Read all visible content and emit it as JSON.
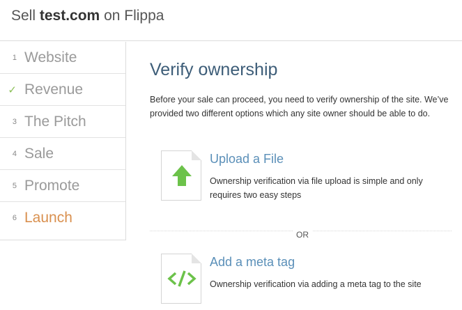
{
  "header": {
    "prefix": "Sell",
    "domain": "test.com",
    "suffix": "on Flippa"
  },
  "sidebar": {
    "steps": [
      {
        "marker": "1",
        "label": "Website",
        "status": "pending"
      },
      {
        "marker": "✓",
        "label": "Revenue",
        "status": "complete"
      },
      {
        "marker": "3",
        "label": "The Pitch",
        "status": "pending"
      },
      {
        "marker": "4",
        "label": "Sale",
        "status": "pending"
      },
      {
        "marker": "5",
        "label": "Promote",
        "status": "pending"
      },
      {
        "marker": "6",
        "label": "Launch",
        "status": "active"
      }
    ]
  },
  "main": {
    "title": "Verify ownership",
    "intro": "Before your sale can proceed, you need to verify ownership of the site. We’ve provided two different options which any site owner should be able to do.",
    "separator": "OR",
    "options": [
      {
        "title": "Upload a File",
        "description": "Ownership verification via file upload is simple and only requires two easy steps",
        "icon": "upload-arrow-icon"
      },
      {
        "title": "Add a meta tag",
        "description": "Ownership verification via adding a meta tag to the site",
        "icon": "code-tag-icon"
      }
    ]
  },
  "colors": {
    "active_step": "#d9904f",
    "check": "#8bbf57",
    "title": "#3d5d78",
    "link": "#5a8fb8",
    "icon_green": "#6cc24a"
  }
}
